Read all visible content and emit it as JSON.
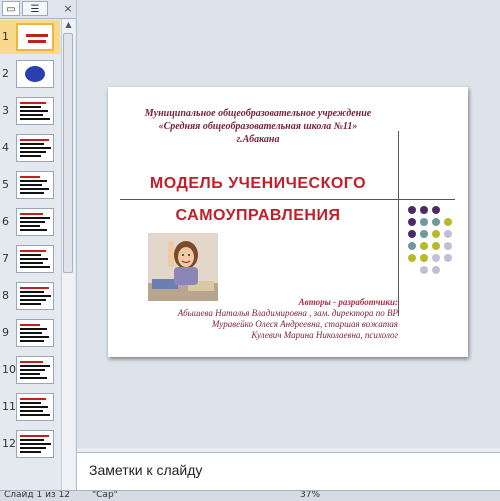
{
  "panel": {
    "tab_slides_icon": "slides-tab-icon",
    "tab_outline_icon": "outline-tab-icon",
    "close_glyph": "×",
    "thumbnails": [
      {
        "num": "1",
        "selected": true
      },
      {
        "num": "2"
      },
      {
        "num": "3"
      },
      {
        "num": "4"
      },
      {
        "num": "5"
      },
      {
        "num": "6"
      },
      {
        "num": "7"
      },
      {
        "num": "8"
      },
      {
        "num": "9"
      },
      {
        "num": "10"
      },
      {
        "num": "11"
      },
      {
        "num": "12"
      }
    ]
  },
  "slide": {
    "org": [
      "Муниципальное  общеобразовательное  учреждение",
      "«Средняя  общеобразовательная   школа №11»",
      "г.Абакана"
    ],
    "title_line1": "МОДЕЛЬ  УЧЕНИЧЕСКОГО",
    "title_line2": "САМОУПРАВЛЕНИЯ",
    "authors_title": "Авторы - разработчики:",
    "authors": [
      "Абышева Наталья Владимировна , зам. директора по ВР",
      "Муравейко Олеся Андреевна, старшая вожатая",
      "Кулевич Марина Николаевна, психолог"
    ],
    "dot_colors": {
      "purple": "#4b2a63",
      "teal": "#6f9a9c",
      "olive": "#b9b92a",
      "lavender": "#c3bed8"
    }
  },
  "notes": {
    "placeholder": "Заметки к слайду"
  },
  "status": {
    "slide_info": "Слайд 1 из 12",
    "theme": "\"Cap\"",
    "zoom": "37%"
  },
  "colors": {
    "title_red": "#c0202a",
    "org_maroon": "#7a1f3a"
  }
}
